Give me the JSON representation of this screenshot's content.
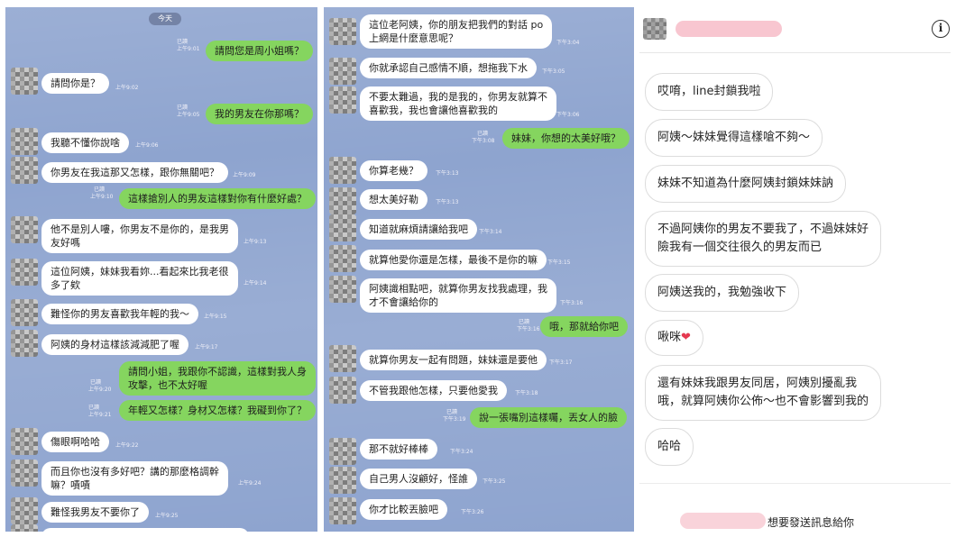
{
  "left_chat": {
    "date_badge": "今天",
    "messages": [
      {
        "side": "right",
        "text": "請問您是周小姐嗎？",
        "read": "已讀",
        "time": "上午9:01"
      },
      {
        "side": "left",
        "text": "請問你是？",
        "time": "上午9:02"
      },
      {
        "side": "right",
        "text": "我的男友在你那嗎？",
        "read": "已讀",
        "time": "上午9:05"
      },
      {
        "side": "left",
        "text": "我聽不懂你說啥",
        "time": "上午9:06"
      },
      {
        "side": "left",
        "text": "你男友在我這那又怎樣，跟你無關吧？",
        "time": "上午9:09"
      },
      {
        "side": "right",
        "text": "這樣搶別人的男友這樣對你有什麼好處？",
        "read": "已讀",
        "time": "上午9:10"
      },
      {
        "side": "left",
        "text": "他不是別人嘍，你男友不是你的，是我男友好嗎",
        "lines": [
          "他不是別人嘍，你男友不是你的，是我男",
          "友好嗎"
        ],
        "time": "上午9:13"
      },
      {
        "side": "left",
        "text": "這位阿姨，妹妹我看妳...看起來比我老很多了欸",
        "lines": [
          "這位阿姨，妹妹我看妳...看起來比我老很",
          "多了欸"
        ],
        "time": "上午9:14"
      },
      {
        "side": "left",
        "text": "難怪你的男友喜歡我年輕的我～",
        "time": "上午9:15"
      },
      {
        "side": "left",
        "text": "阿姨的身材這樣該減減肥了喔",
        "time": "上午9:17"
      },
      {
        "side": "right",
        "text": "請問小姐，我跟你不認識，這樣對我人身攻擊，也不太好喔",
        "lines": [
          "請問小姐，我跟你不認識，這樣對我人身",
          "攻擊，也不太好喔"
        ],
        "read": "已讀",
        "time": "上午9:20"
      },
      {
        "side": "right",
        "text": "年輕又怎樣？身材又怎樣？我礙到你了？",
        "read": "已讀",
        "time": "上午9:21"
      },
      {
        "side": "left",
        "text": "傷眼啊哈哈",
        "time": "上午9:22"
      },
      {
        "side": "left",
        "text": "而且你也沒有多好吧？講的那麼格調幹嘛？嘖嘖",
        "lines": [
          "而且你也沒有多好吧？講的那麼格調幹",
          "嘛？嘖嘖"
        ],
        "time": "上午9:24"
      },
      {
        "side": "left",
        "text": "難怪我男友不要你了",
        "time": "上午9:25"
      }
    ]
  },
  "middle_chat": {
    "messages": [
      {
        "side": "left",
        "text": "這位老阿姨，你的朋友把我們的對話 po 上網是什麼意思呢？",
        "lines": [
          "這位老阿姨，你的朋友把我們的對話 po",
          "上網是什麼意思呢？"
        ],
        "time": "下午3:04"
      },
      {
        "side": "left",
        "text": "你就承認自己感情不順，想拖我下水",
        "time": "下午3:05"
      },
      {
        "side": "left",
        "text": "不要太難過，我的是我的，你男友就算不喜歡我，我也會讓他喜歡我的",
        "lines": [
          "不要太難過，我的是我的，你男友就算不",
          "喜歡我，我也會讓他喜歡我的"
        ],
        "time": "下午3:06"
      },
      {
        "side": "right",
        "text": "妹妹，你想的太美好哦？",
        "read": "已讀",
        "time": "下午3:08"
      },
      {
        "side": "left",
        "text": "你算老幾？",
        "time": "下午3:13"
      },
      {
        "side": "left",
        "text": "想太美好勒",
        "time": "下午3:13"
      },
      {
        "side": "left",
        "text": "知道就麻煩請讓給我吧",
        "time": "下午3:14"
      },
      {
        "side": "left",
        "text": "就算他愛你還是怎樣，最後不是你的嘛",
        "time": "下午3:15"
      },
      {
        "side": "left",
        "text": "阿姨識相點吧，就算你男友找我處理，我才不會讓給你的",
        "lines": [
          "阿姨識相點吧，就算你男友找我處理，我",
          "才不會讓給你的"
        ],
        "time": "下午3:16"
      },
      {
        "side": "right",
        "text": "哦，那就給你吧",
        "read": "已讀",
        "time": "下午3:16"
      },
      {
        "side": "left",
        "text": "就算你男友一起有問題，妹妹還是要他",
        "time": "下午3:17"
      },
      {
        "side": "left",
        "text": "不管我跟他怎樣，只要他愛我",
        "time": "下午3:18"
      },
      {
        "side": "right",
        "text": "說一張嘴別這樣囑，丟女人的臉",
        "read": "已讀",
        "time": "下午3:19"
      },
      {
        "side": "left",
        "text": "那不就好棒棒",
        "time": "下午3:24"
      },
      {
        "side": "left",
        "text": "自己男人沒顧好，怪誰",
        "time": "下午3:25"
      },
      {
        "side": "left",
        "text": "你才比較丟臉吧",
        "time": "下午3:26"
      }
    ]
  },
  "right_chat": {
    "info_icon": "i",
    "messages": [
      {
        "text": "哎唷，line封鎖我啦"
      },
      {
        "text": "阿姨～妹妹覺得這樣嗆不夠～"
      },
      {
        "text": "妹妹不知道為什麼阿姨封鎖妹妹訥"
      },
      {
        "text": "不過阿姨你的男友不要我了，不過妹妹好險我有一個交往很久的男友而已",
        "lines": [
          "不過阿姨你的男友不要我了，不過妹妹好",
          "險我有一個交往很久的男友而已"
        ]
      },
      {
        "text": "阿姨送我的，我勉強收下"
      },
      {
        "text": "啾咪",
        "emoji": "❤"
      },
      {
        "text": "還有妹妹我跟男友同居，阿姨別擾亂我哦，就算阿姨你公佈～也不會影響到我的",
        "lines": [
          "還有妹妹我跟男友同居，阿姨別擾亂我",
          "哦，就算阿姨你公佈～也不會影響到我的"
        ]
      },
      {
        "text": "哈哈"
      }
    ],
    "footer_text": "想要發送訊息給你"
  }
}
